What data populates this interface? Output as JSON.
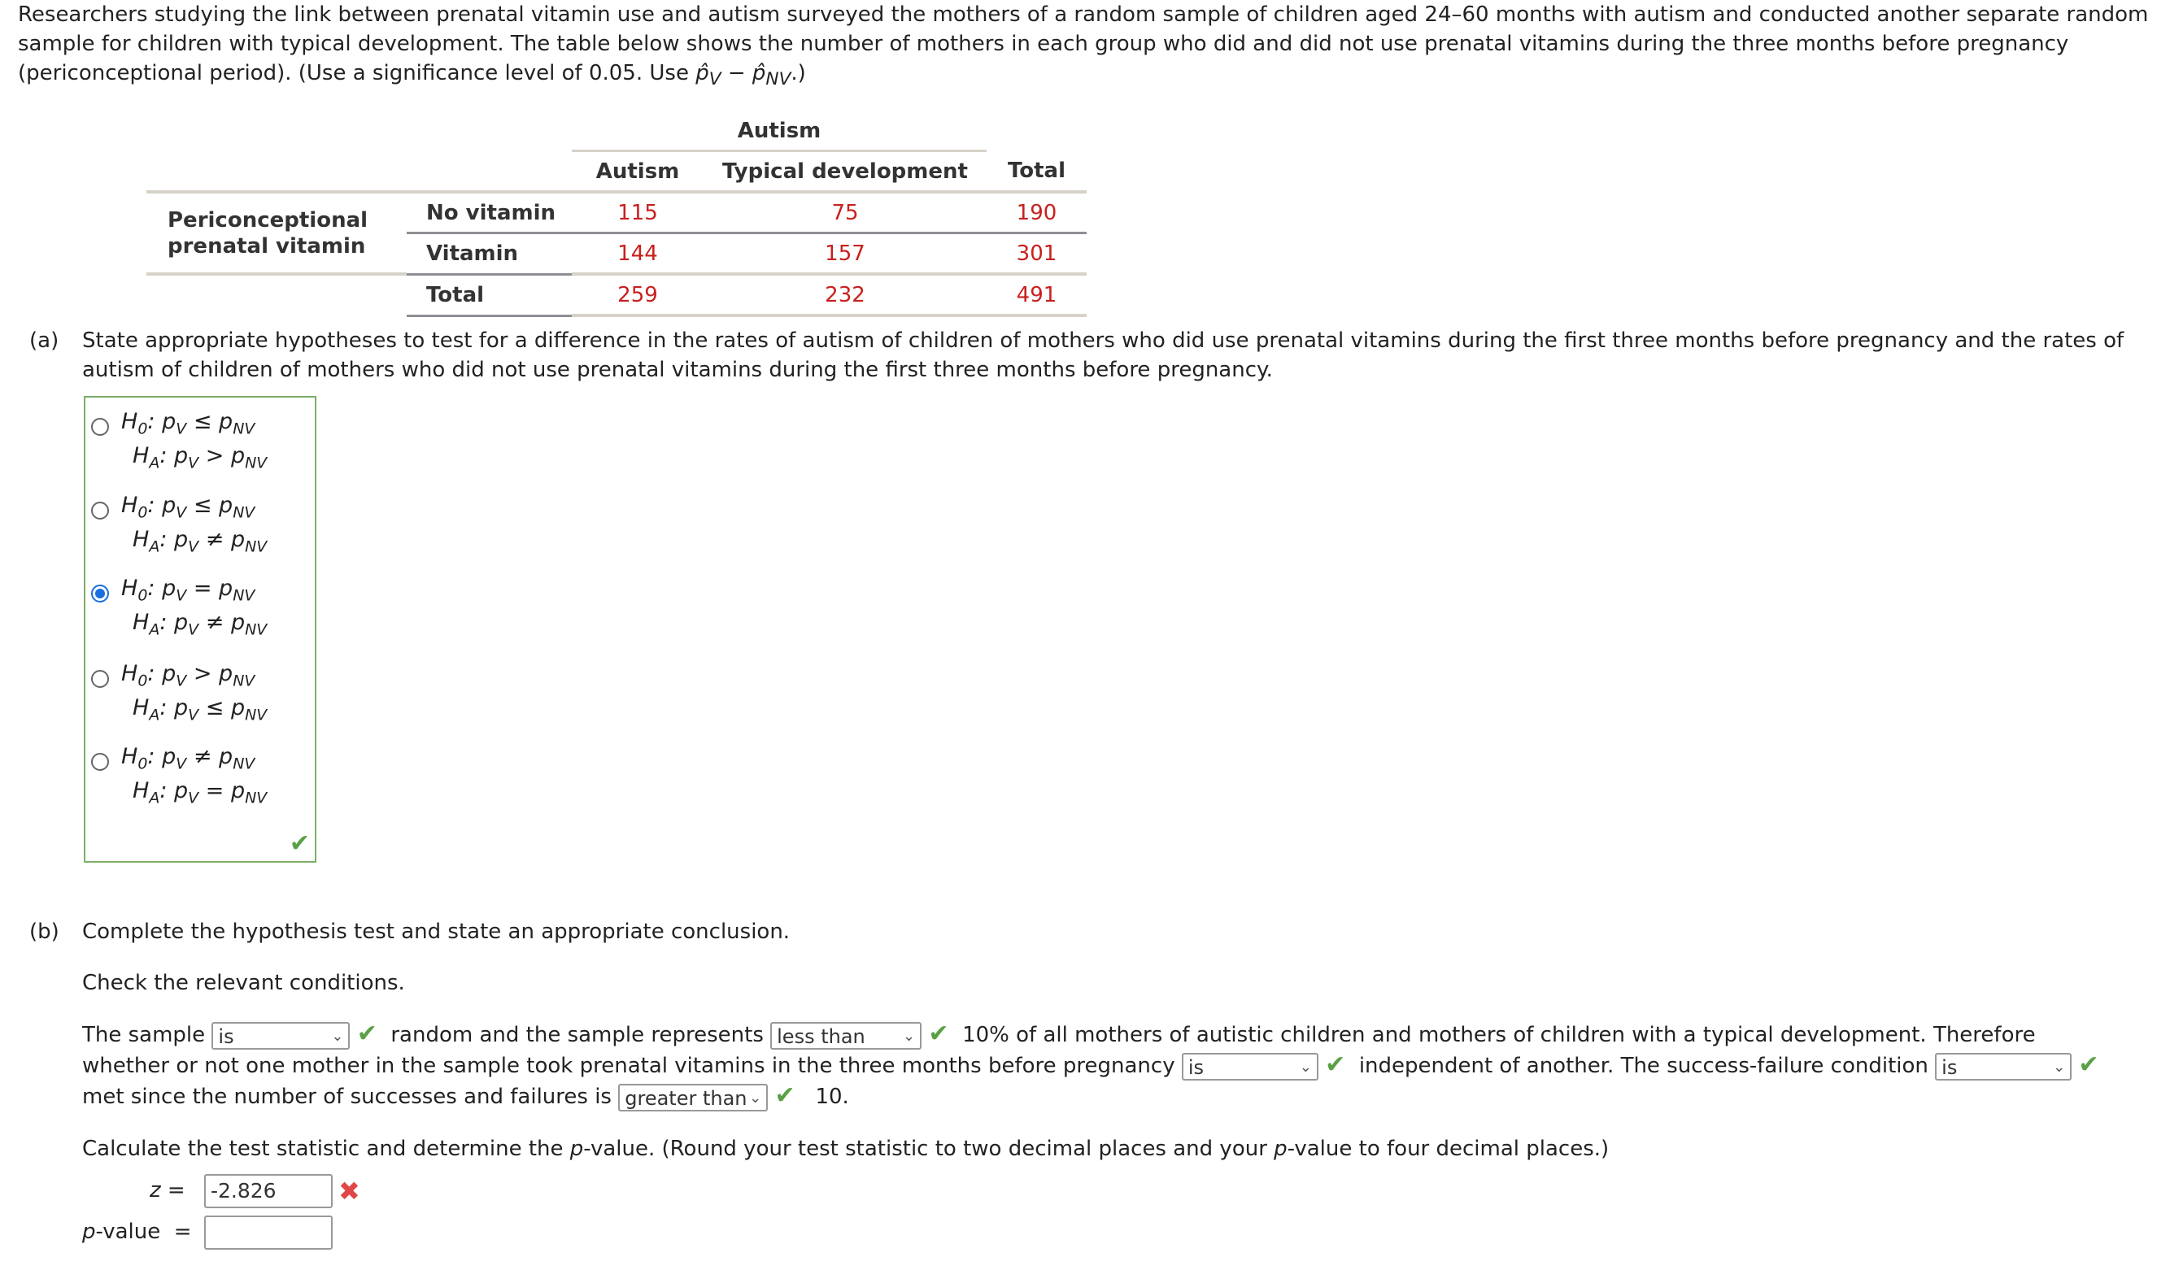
{
  "intro": {
    "line1": "Researchers studying the link between prenatal vitamin use and autism surveyed the mothers of a random sample of children aged 24–60 months with autism and conducted another separate random",
    "line2": "sample for children with typical development. The table below shows the number of mothers in each group who did and did not use prenatal vitamins during the three months before pregnancy",
    "line3_prefix": "(periconceptional period). (Use a significance level of 0.05. Use ",
    "p_hat": "p̂",
    "sub_v": "V",
    "minus": " − ",
    "sub_nv": "NV",
    "line3_suffix": ".)"
  },
  "table": {
    "group_header": "Autism",
    "col_headers": [
      "Autism",
      "Typical development",
      "Total"
    ],
    "row_group_label": [
      "Periconceptional",
      "prenatal vitamin"
    ],
    "rows": [
      {
        "label": "No vitamin",
        "values": [
          "115",
          "75",
          "190"
        ]
      },
      {
        "label": "Vitamin",
        "values": [
          "144",
          "157",
          "301"
        ]
      },
      {
        "label": "Total",
        "values": [
          "259",
          "232",
          "491"
        ]
      }
    ]
  },
  "part_a": {
    "label": "(a)",
    "line1": "State appropriate hypotheses to test for a difference in the rates of autism of children of mothers who did use prenatal vitamins during the first three months before pregnancy and the rates of",
    "line2": "autism of children of mothers who did not use prenatal vitamins during the first three months before pregnancy.",
    "options": [
      {
        "h0": "≤",
        "ha": ">",
        "selected": false
      },
      {
        "h0": "≤",
        "ha": "≠",
        "selected": false
      },
      {
        "h0": "=",
        "ha": "≠",
        "selected": true
      },
      {
        "h0": ">",
        "ha": "≤",
        "selected": false
      },
      {
        "h0": "≠",
        "ha": "=",
        "selected": false
      }
    ],
    "h0_label": "H",
    "h0_sub": "0",
    "ha_sub": "A",
    "p": "p",
    "sub_v": "V",
    "sub_nv": "NV",
    "status": "correct"
  },
  "part_b": {
    "label": "(b)",
    "title": "Complete the hypothesis test and state an appropriate conclusion.",
    "conditions_heading": "Check the relevant conditions.",
    "s1": "The sample",
    "dd1": "is",
    "s2": "random and the sample represents",
    "dd2": "less than",
    "s3": "10% of all mothers of autistic children and mothers of children with a typical development. Therefore",
    "s4": "whether or not one mother in the sample took prenatal vitamins in the three months before pregnancy",
    "dd3": "is",
    "s5": "independent of another. The success-failure condition",
    "dd4": "is",
    "s6": "met since the number of successes and failures is",
    "dd5": "greater than",
    "s7": "10.",
    "calc_a": "Calculate the test statistic and determine the ",
    "calc_p": "p",
    "calc_b": "-value. (Round your test statistic to two decimal places and your ",
    "calc_c": "-value to four decimal places.)",
    "z_label": "z",
    "eq": "=",
    "z_value": "-2.826",
    "pval_label_p": "p",
    "pval_label_rest": "-value",
    "pval_value": "",
    "colors": {
      "correct": "#5aa046",
      "incorrect": "#e04848",
      "data": "#c8201e",
      "selected_radio": "#1a6fe0"
    }
  }
}
